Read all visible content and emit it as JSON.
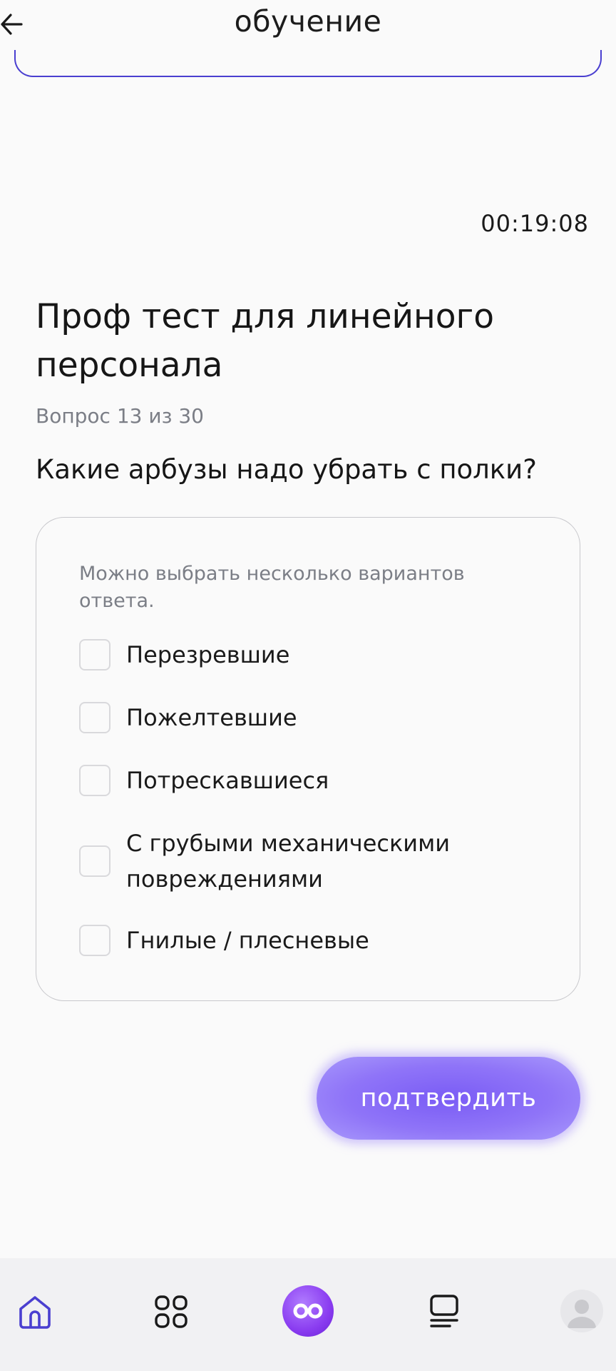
{
  "header": {
    "title": "обучение"
  },
  "timer": "00:19:08",
  "test": {
    "title": "Проф тест для линейного персонала",
    "counter": "Вопрос 13 из 30",
    "question": "Какие арбузы надо убрать с полки?"
  },
  "answers": {
    "hint": "Можно выбрать несколько вариантов ответа.",
    "options": [
      {
        "label": "Перезревшие",
        "checked": false
      },
      {
        "label": "Пожелтевшие",
        "checked": false
      },
      {
        "label": "Потрескавшиеся",
        "checked": false
      },
      {
        "label": "С грубыми механическими повреждениями",
        "checked": false
      },
      {
        "label": "Гнилые / плесневые",
        "checked": false
      }
    ]
  },
  "confirm_label": "подтвердить",
  "colors": {
    "accent": "#4a3fd0",
    "button": "#8f74f8",
    "nav_center": "#8a3cf0"
  },
  "nav": {
    "items": [
      {
        "icon": "home-icon",
        "active": true
      },
      {
        "icon": "grid-icon",
        "active": false
      },
      {
        "icon": "infinity-logo-icon",
        "active": false
      },
      {
        "icon": "courses-stack-icon",
        "active": false
      },
      {
        "icon": "avatar",
        "active": false
      }
    ]
  }
}
